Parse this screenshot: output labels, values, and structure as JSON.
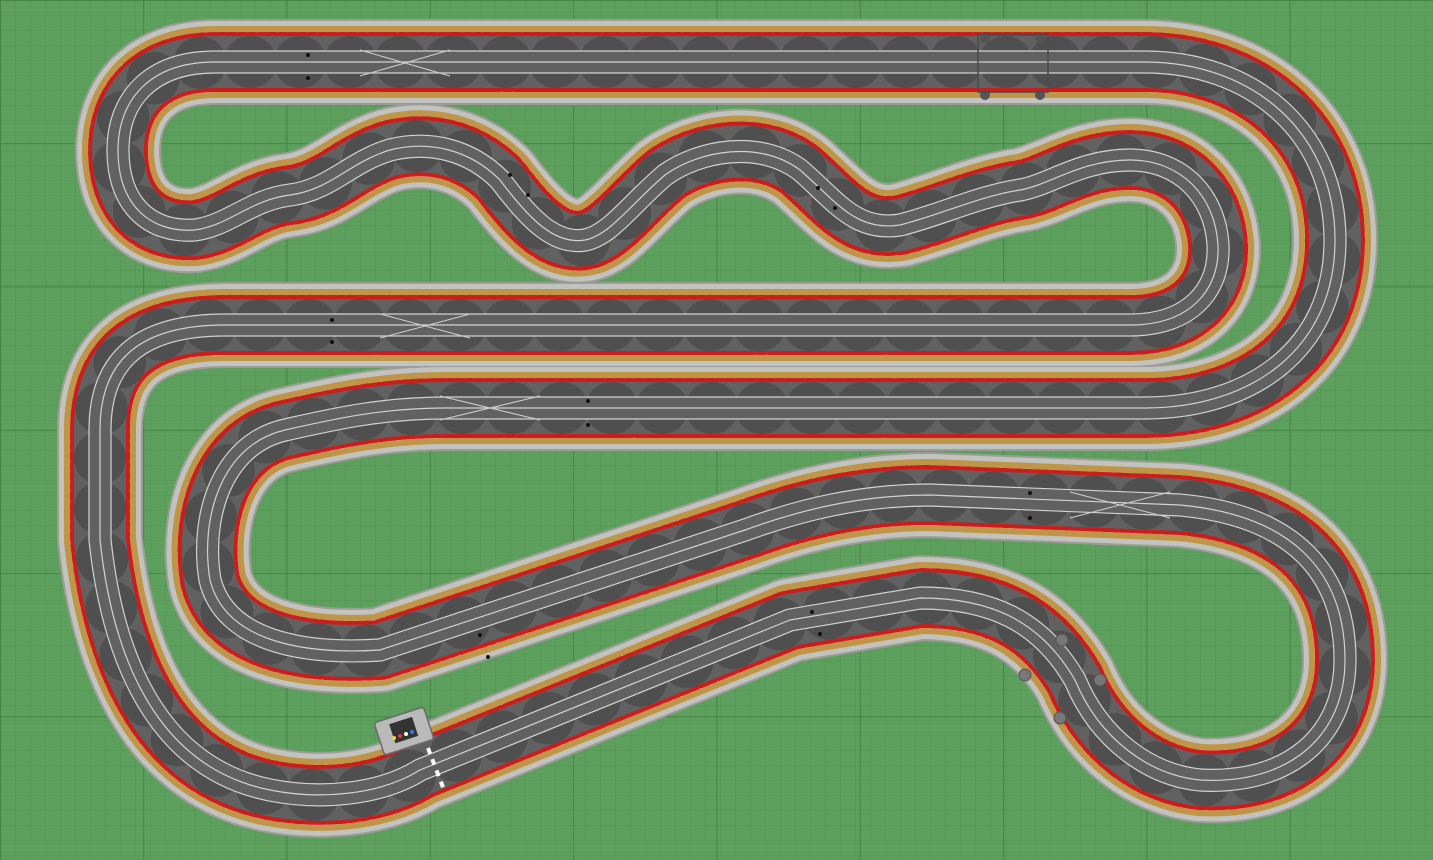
{
  "colors": {
    "grass": "#5da05d",
    "grid_minor": "#4e8f4e",
    "grid_major": "#3f7a3f",
    "shoulder": "#c2c2be",
    "shoulder_edge": "#9d9d98",
    "sand": "#bf9547",
    "kerb_red": "#cc1d1d",
    "kerb_white": "#ffffff",
    "asphalt": "#616161",
    "lane_line": "#d2d2d2",
    "seam": "#4b4b4b",
    "building": "#9a9a9a"
  },
  "icons": {
    "tower": "control-tower-icon",
    "flag": "chequered-start-line-icon",
    "bridge": "bridge-pillar-icon"
  }
}
